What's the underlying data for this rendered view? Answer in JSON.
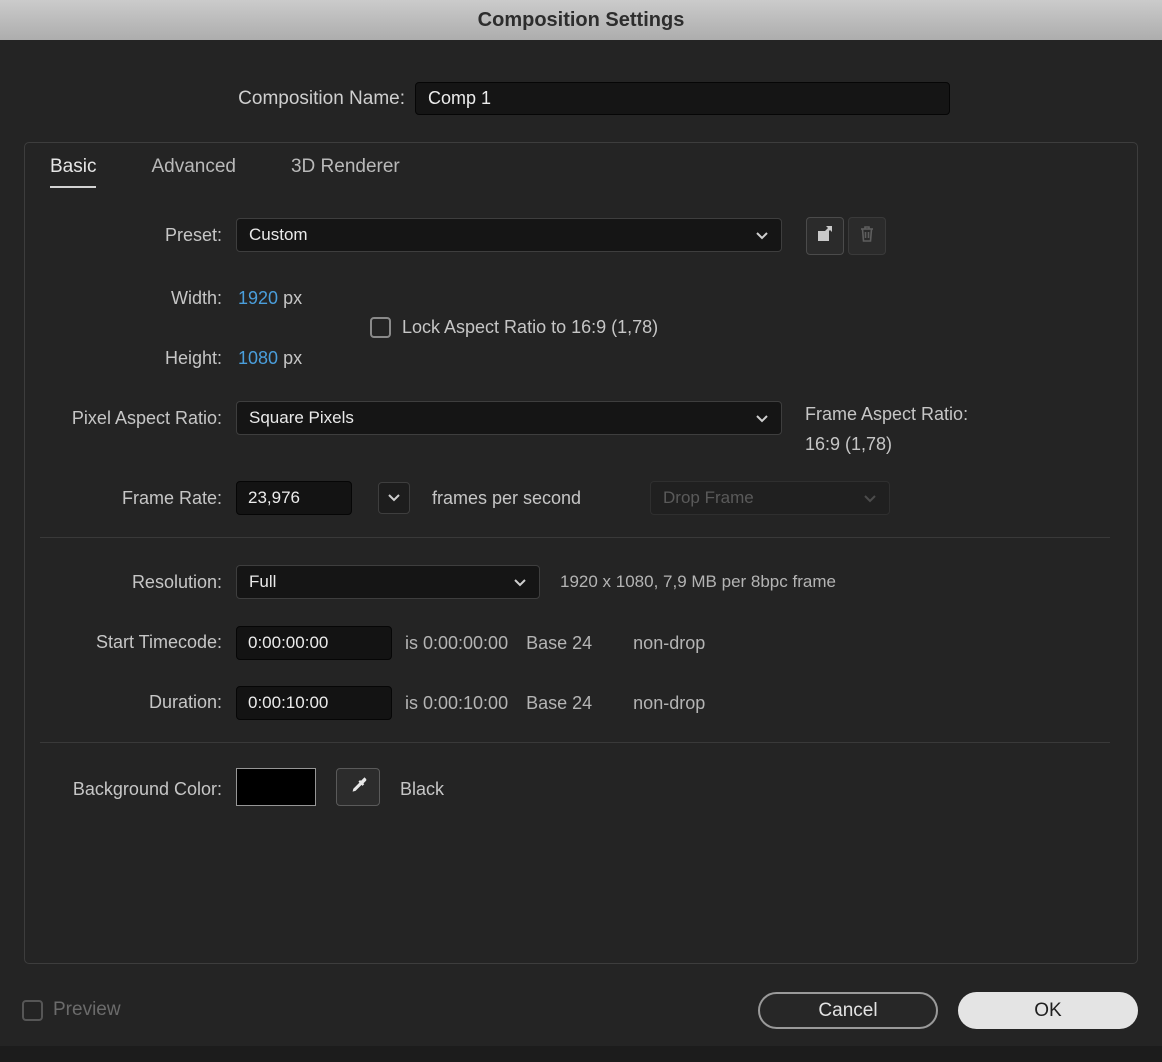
{
  "window": {
    "title": "Composition Settings"
  },
  "composition_name": {
    "label": "Composition Name:",
    "value": "Comp 1"
  },
  "tabs": [
    {
      "label": "Basic"
    },
    {
      "label": "Advanced"
    },
    {
      "label": "3D Renderer"
    }
  ],
  "preset": {
    "label": "Preset:",
    "value": "Custom"
  },
  "dimensions": {
    "width_label": "Width:",
    "width_value": "1920",
    "width_unit": "px",
    "height_label": "Height:",
    "height_value": "1080",
    "height_unit": "px",
    "lock_label": "Lock Aspect Ratio to 16:9 (1,78)",
    "lock_checked": false
  },
  "pixel_aspect": {
    "label": "Pixel Aspect Ratio:",
    "value": "Square Pixels"
  },
  "frame_aspect": {
    "label": "Frame Aspect Ratio:",
    "value": "16:9 (1,78)"
  },
  "frame_rate": {
    "label": "Frame Rate:",
    "value": "23,976",
    "units": "frames per second",
    "drop_frame_value": "Drop Frame",
    "drop_frame_enabled": false
  },
  "resolution": {
    "label": "Resolution:",
    "value": "Full",
    "info": "1920 x 1080, 7,9 MB per 8bpc frame"
  },
  "start_timecode": {
    "label": "Start Timecode:",
    "value": "0:00:00:00",
    "is_text": "is 0:00:00:00",
    "base_text": "Base 24",
    "drop_text": "non-drop"
  },
  "duration": {
    "label": "Duration:",
    "value": "0:00:10:00",
    "is_text": "is 0:00:10:00",
    "base_text": "Base 24",
    "drop_text": "non-drop"
  },
  "background": {
    "label": "Background Color:",
    "color_name": "Black",
    "color_hex": "#000000"
  },
  "footer": {
    "preview": "Preview",
    "preview_checked": false,
    "cancel": "Cancel",
    "ok": "OK"
  },
  "colors": {
    "accent_blue": "#4a9edb",
    "dialog_bg": "#242424",
    "titlebar_bg": "#bdbdbd"
  }
}
